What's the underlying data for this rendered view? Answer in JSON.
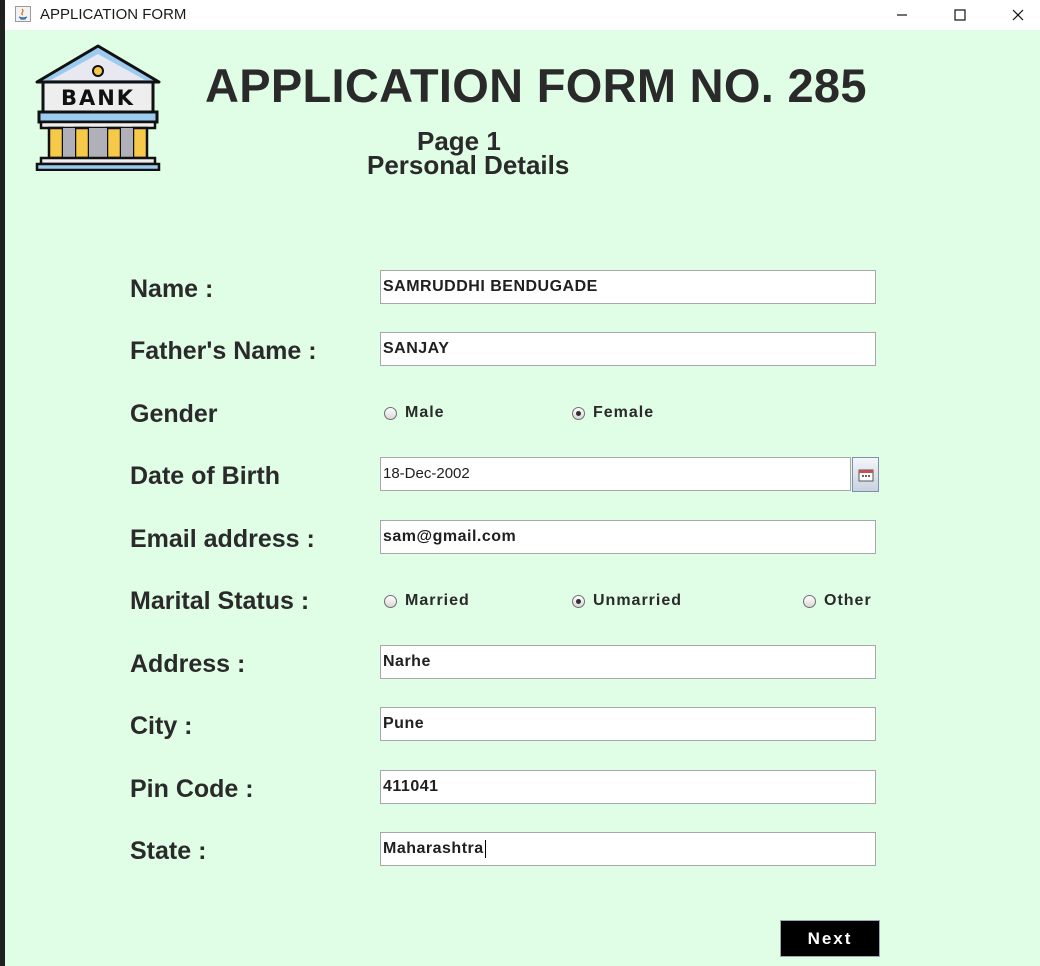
{
  "window": {
    "title": "APPLICATION FORM",
    "controls": [
      "minimize-icon",
      "maximize-icon",
      "close-icon"
    ]
  },
  "logo": {
    "text": "BANK",
    "icon": "bank-building-icon"
  },
  "header": {
    "title": "APPLICATION FORM NO. 285",
    "page": "Page 1",
    "subtitle": "Personal Details"
  },
  "form": {
    "name": {
      "label": "Name :",
      "value": "SAMRUDDHI BENDUGADE"
    },
    "father_name": {
      "label": "Father's Name :",
      "value": "SANJAY"
    },
    "gender": {
      "label": "Gender",
      "options": [
        {
          "label": "Male",
          "selected": false
        },
        {
          "label": "Female",
          "selected": true
        }
      ]
    },
    "dob": {
      "label": "Date of Birth",
      "value": "18-Dec-2002",
      "icon": "calendar-icon"
    },
    "email": {
      "label": "Email address :",
      "value": "sam@gmail.com"
    },
    "marital_status": {
      "label": "Marital Status :",
      "options": [
        {
          "label": "Married",
          "selected": false
        },
        {
          "label": "Unmarried",
          "selected": true
        },
        {
          "label": "Other",
          "selected": false
        }
      ]
    },
    "address": {
      "label": "Address :",
      "value": "Narhe"
    },
    "city": {
      "label": "City :",
      "value": "Pune"
    },
    "pin_code": {
      "label": "Pin Code :",
      "value": "411041"
    },
    "state": {
      "label": "State :",
      "value": "Maharashtra"
    }
  },
  "actions": {
    "next_label": "Next"
  },
  "colors": {
    "background": "#e0fde6",
    "text": "#2a2a2a",
    "button": "#000000"
  }
}
